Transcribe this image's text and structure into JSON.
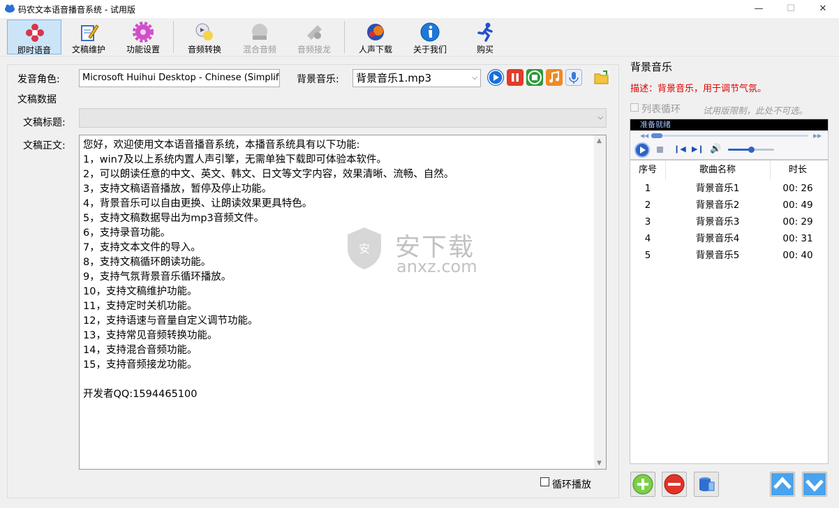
{
  "window": {
    "title": "码农文本语音播音系统 - 试用版",
    "controls": {
      "minimize": "—",
      "maximize": "☐",
      "close": "✕"
    }
  },
  "toolbar": {
    "items": [
      {
        "label": "即时语音",
        "icon": "flower-icon",
        "active": true
      },
      {
        "label": "文稿维护",
        "icon": "edit-document-icon"
      },
      {
        "label": "功能设置",
        "icon": "gear-icon"
      },
      {
        "label": "音频转换",
        "icon": "audio-convert-icon"
      },
      {
        "label": "混合音频",
        "icon": "mix-audio-icon",
        "disabled": true
      },
      {
        "label": "音频接龙",
        "icon": "audio-chain-icon",
        "disabled": true
      },
      {
        "label": "人声下载",
        "icon": "voice-download-icon"
      },
      {
        "label": "关于我们",
        "icon": "info-icon"
      },
      {
        "label": "购买",
        "icon": "runner-icon"
      }
    ]
  },
  "voice": {
    "label": "发音角色:",
    "value": "Microsoft Huihui Desktop - Chinese (Simplifie"
  },
  "bgmusic": {
    "label": "背景音乐:",
    "value": "背景音乐1.mp3",
    "buttons": [
      "play-icon",
      "pause-icon",
      "stop-icon",
      "music-note-icon",
      "microphone-icon",
      "open-folder-icon"
    ]
  },
  "doc": {
    "group_title": "文稿数据",
    "title_label": "文稿标题:",
    "title_value": "",
    "body_label": "文稿正文:",
    "lines": [
      "您好，欢迎使用文本语音播音系统，本播音系统具有以下功能:",
      "1，win7及以上系统内置人声引擎，无需单独下载即可体验本软件。",
      "2，可以朗读任意的中文、英文、韩文、日文等文字内容，效果清晰、流畅、自然。",
      "3，支持文稿语音播放，暂停及停止功能。",
      "4，背景音乐可以自由更换、让朗读效果更具特色。",
      "5，支持文稿数据导出为mp3音频文件。",
      "6，支持录音功能。",
      "7，支持文本文件的导入。",
      "8，支持文稿循环朗读功能。",
      "9，支持气氛背景音乐循环播放。",
      "10，支持文稿维护功能。",
      "11，支持定时关机功能。",
      "12，支持语速与音量自定义调节功能。",
      "13，支持常见音频转换功能。",
      "14，支持混合音频功能。",
      "15，支持音频接龙功能。",
      "",
      "开发者QQ:1594465100"
    ],
    "loop_label": "循环播放"
  },
  "watermark": {
    "main": "安下载",
    "sub": "anxz.com"
  },
  "right": {
    "title": "背景音乐",
    "desc": "描述：背景音乐，用于调节气氛。",
    "list_loop_label": "列表循环",
    "trial_note": "试用版限制，此处不可选。",
    "player_status": "准备就绪",
    "volume_level": 0.5,
    "table": {
      "headers": [
        "序号",
        "歌曲名称",
        "时长"
      ],
      "rows": [
        {
          "no": "1",
          "name": "背景音乐1",
          "duration": "00: 26"
        },
        {
          "no": "2",
          "name": "背景音乐2",
          "duration": "00: 49"
        },
        {
          "no": "3",
          "name": "背景音乐3",
          "duration": "00: 29"
        },
        {
          "no": "4",
          "name": "背景音乐4",
          "duration": "00: 31"
        },
        {
          "no": "5",
          "name": "背景音乐5",
          "duration": "00: 40"
        }
      ]
    },
    "bottom_buttons": [
      "add-icon",
      "remove-icon",
      "database-icon",
      "move-up-icon",
      "move-down-icon"
    ]
  }
}
